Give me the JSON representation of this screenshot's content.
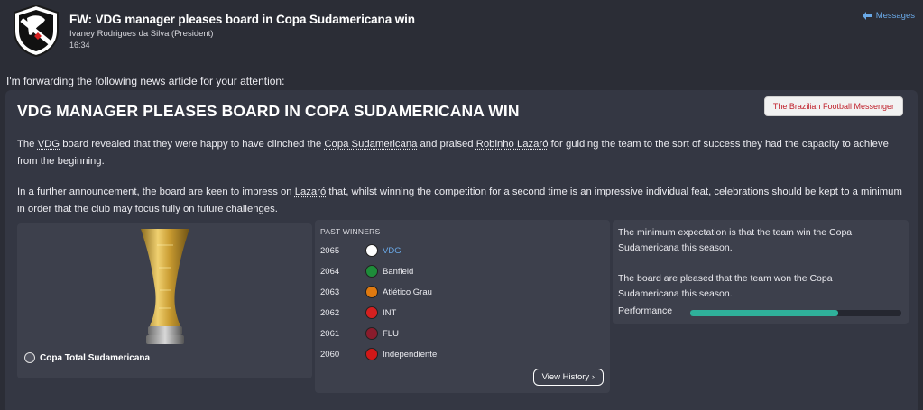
{
  "header": {
    "subject": "FW: VDG manager pleases board in Copa Sudamericana win",
    "sender": "Ivaney Rodrigues da Silva  (President)",
    "time": "16:34",
    "messages_label": "Messages"
  },
  "intro": "I'm forwarding the following news article for your attention:",
  "article": {
    "headline": "VDG MANAGER PLEASES BOARD IN COPA SUDAMERICANA WIN",
    "source": "The Brazilian Football Messenger",
    "p1": {
      "a": "The ",
      "club": "VDG",
      "b": " board revealed that they were happy to have clinched the ",
      "competition": "Copa Sudamericana",
      "c": " and praised ",
      "manager": "Robinho Lazaró",
      "d": " for guiding the team to the sort of success they had the capacity to achieve from the beginning."
    },
    "p2": {
      "a": "In a further announcement, the board are keen to impress on ",
      "manager": "Lazaró",
      "b": " that, whilst winning the competition for a second time is an impressive individual feat, celebrations should be kept to a minimum in order that the club may focus fully on future challenges."
    }
  },
  "trophy": {
    "label": "Copa Total Sudamericana"
  },
  "past_winners": {
    "title": "PAST WINNERS",
    "rows": [
      {
        "year": "2065",
        "club": "VDG",
        "badge_color": "#ffffff"
      },
      {
        "year": "2064",
        "club": "Banfield",
        "badge_color": "#1e8c3a"
      },
      {
        "year": "2063",
        "club": "Atlético Grau",
        "badge_color": "#e07a10"
      },
      {
        "year": "2062",
        "club": "INT",
        "badge_color": "#d42020"
      },
      {
        "year": "2061",
        "club": "FLU",
        "badge_color": "#8a1c2c"
      },
      {
        "year": "2060",
        "club": "Independiente",
        "badge_color": "#d01818"
      }
    ],
    "history_button": "View History"
  },
  "expectations": {
    "line1": "The minimum expectation is that the team win the Copa Sudamericana this season.",
    "line2": "The board are pleased that the team won the Copa Sudamericana this season.",
    "performance_label": "Performance",
    "performance_value": 0.7
  },
  "colors": {
    "accent_link": "#6aa9e8",
    "performance_bar": "#2fb09a",
    "source_badge_text": "#c0202b"
  }
}
